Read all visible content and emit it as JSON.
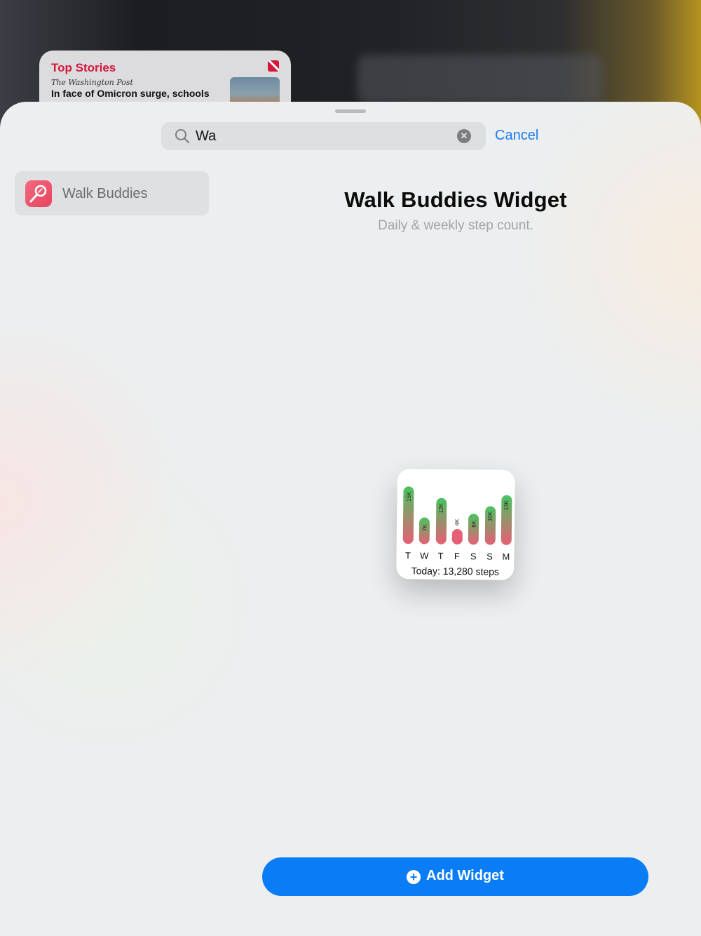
{
  "background": {
    "news_widget": {
      "title": "Top Stories",
      "source": "The Washington Post",
      "headline": "In face of Omicron surge, schools"
    }
  },
  "search": {
    "value": "Wa",
    "clear_icon": "xmark-circle-icon",
    "cancel_label": "Cancel"
  },
  "sidebar": {
    "items": [
      {
        "label": "Walk Buddies",
        "icon": "walk-buddies-app-icon"
      }
    ]
  },
  "detail": {
    "title": "Walk  Buddies Widget",
    "subtitle": "Daily & weekly step count."
  },
  "widget": {
    "today_label": "Today:  13,280 steps",
    "colors": {
      "bar_top": "#47c45e",
      "bar_bottom": "#e85e76"
    }
  },
  "chart_data": {
    "type": "bar",
    "categories": [
      "T",
      "W",
      "T",
      "F",
      "S",
      "S",
      "M"
    ],
    "values": [
      15,
      7,
      12,
      4,
      8,
      10,
      13
    ],
    "labels": [
      "15K",
      "7K",
      "12K",
      "4K",
      "8K",
      "10K",
      "13K"
    ],
    "ylim": [
      0,
      15
    ]
  },
  "actions": {
    "add_label": "Add Widget"
  },
  "colors": {
    "accent": "#0a7cf6",
    "news_red": "#d3183b"
  }
}
